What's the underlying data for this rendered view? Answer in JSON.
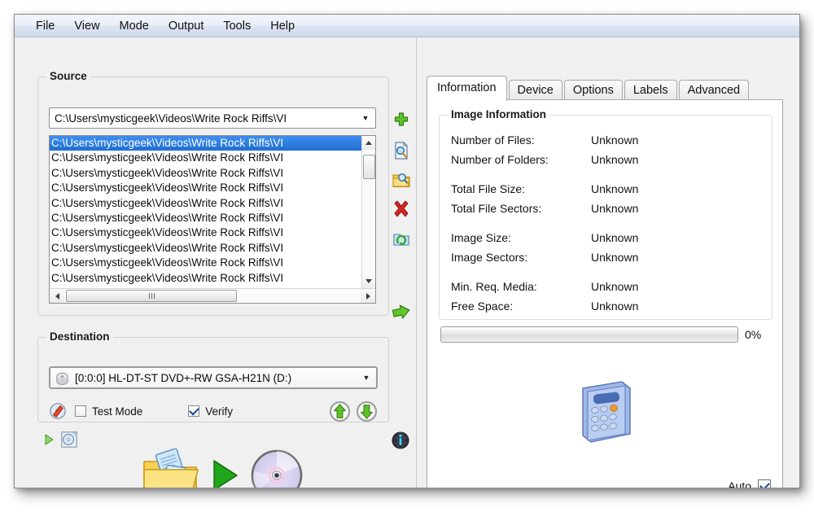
{
  "menubar": {
    "items": [
      {
        "label": "File"
      },
      {
        "label": "View"
      },
      {
        "label": "Mode"
      },
      {
        "label": "Output"
      },
      {
        "label": "Tools"
      },
      {
        "label": "Help"
      }
    ]
  },
  "source": {
    "group_title": "Source",
    "combo_value": "C:\\Users\\mysticgeek\\Videos\\Write Rock Riffs\\VI",
    "list_items": [
      "C:\\Users\\mysticgeek\\Videos\\Write Rock Riffs\\VI",
      "C:\\Users\\mysticgeek\\Videos\\Write Rock Riffs\\VI",
      "C:\\Users\\mysticgeek\\Videos\\Write Rock Riffs\\VI",
      "C:\\Users\\mysticgeek\\Videos\\Write Rock Riffs\\VI",
      "C:\\Users\\mysticgeek\\Videos\\Write Rock Riffs\\VI",
      "C:\\Users\\mysticgeek\\Videos\\Write Rock Riffs\\VI",
      "C:\\Users\\mysticgeek\\Videos\\Write Rock Riffs\\VI",
      "C:\\Users\\mysticgeek\\Videos\\Write Rock Riffs\\VI",
      "C:\\Users\\mysticgeek\\Videos\\Write Rock Riffs\\VI",
      "C:\\Users\\mysticgeek\\Videos\\Write Rock Riffs\\VI"
    ],
    "selected_index": 0,
    "tool_icons": [
      {
        "name": "add-icon",
        "title": "Add"
      },
      {
        "name": "find-file-icon",
        "title": "Find file"
      },
      {
        "name": "find-folder-icon",
        "title": "Find folder"
      },
      {
        "name": "remove-icon",
        "title": "Remove"
      },
      {
        "name": "refresh-icon",
        "title": "Refresh"
      },
      {
        "name": "go-icon",
        "title": "Go"
      }
    ]
  },
  "destination": {
    "group_title": "Destination",
    "combo_value": "[0:0:0] HL-DT-ST DVD+-RW GSA-H21N (D:)",
    "test_mode_label": "Test Mode",
    "test_mode_checked": false,
    "verify_label": "Verify",
    "verify_checked": true,
    "eject_icon": "eject-up-icon",
    "load_icon": "load-down-icon",
    "erase_icon": "erase-disc-icon"
  },
  "bottom_toolbar": {
    "play_icon": "play-small-icon",
    "disc_icon": "disc-small-icon",
    "globe_icon": "globe-info-icon",
    "burn_folder_icon": "folder-documents-icon",
    "burn_arrow_icon": "green-play-arrow-icon",
    "burn_disc_icon": "cd-disc-icon"
  },
  "tabs": [
    {
      "label": "Information",
      "active": true
    },
    {
      "label": "Device",
      "active": false
    },
    {
      "label": "Options",
      "active": false
    },
    {
      "label": "Labels",
      "active": false
    },
    {
      "label": "Advanced",
      "active": false
    }
  ],
  "information": {
    "group_title": "Image Information",
    "rows": [
      {
        "label": "Number of Files:",
        "value": "Unknown"
      },
      {
        "label": "Number of Folders:",
        "value": "Unknown"
      },
      {
        "label": "Total File Size:",
        "value": "Unknown"
      },
      {
        "label": "Total File Sectors:",
        "value": "Unknown"
      },
      {
        "label": "Image Size:",
        "value": "Unknown"
      },
      {
        "label": "Image Sectors:",
        "value": "Unknown"
      },
      {
        "label": "Min. Req. Media:",
        "value": "Unknown"
      },
      {
        "label": "Free Space:",
        "value": "Unknown"
      }
    ],
    "progress_percent_label": "0%",
    "progress_value": 0,
    "calculator_icon": "calculator-icon",
    "auto_label": "Auto",
    "auto_checked": true
  },
  "colors": {
    "accent_selection": "#2a7fe0",
    "window_bg": "#f0f0f0",
    "panel_bg": "#ffffff",
    "green_icon": "#4caf1d",
    "red_icon": "#d12a2a"
  }
}
